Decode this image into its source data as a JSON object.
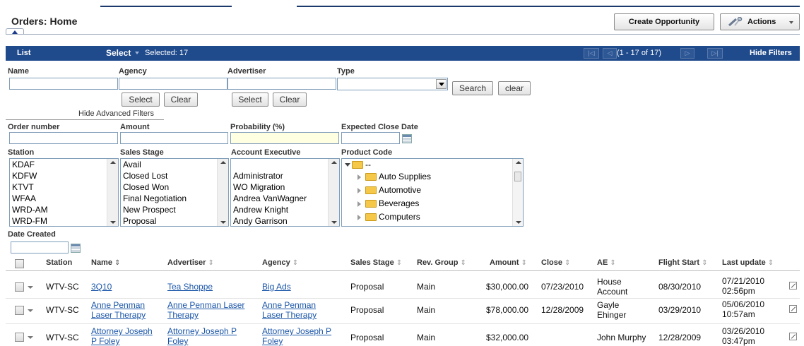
{
  "header": {
    "title": "Orders: Home",
    "create_label": "Create Opportunity",
    "actions_label": "Actions"
  },
  "listbar": {
    "list_label": "List",
    "select_label": "Select",
    "selected_text": "Selected:  17",
    "pager_text": "(1 - 17 of 17)",
    "hide_filters": "Hide Filters"
  },
  "filters": {
    "name_label": "Name",
    "agency_label": "Agency",
    "advertiser_label": "Advertiser",
    "type_label": "Type",
    "select_btn": "Select",
    "clear_btn": "Clear",
    "search_btn": "Search",
    "clear_lower_btn": "clear",
    "hide_advanced": "Hide Advanced Filters",
    "order_number_label": "Order number",
    "amount_label": "Amount",
    "probability_label": "Probability (%)",
    "expected_close_label": "Expected Close Date",
    "station_label": "Station",
    "sales_stage_label": "Sales Stage",
    "account_exec_label": "Account Executive",
    "product_code_label": "Product Code",
    "date_created_label": "Date Created",
    "stations": [
      "KDAF",
      "KDFW",
      "KTVT",
      "WFAA",
      "WRD-AM",
      "WRD-FM"
    ],
    "sales_stages": [
      "Avail",
      "Closed Lost",
      "Closed Won",
      "Final Negotiation",
      "New Prospect",
      "Proposal"
    ],
    "account_execs": [
      "",
      "Administrator",
      "WO Migration",
      "Andrea VanWagner",
      "Andrew Knight",
      "Andy Garrison"
    ],
    "product_root": "--",
    "product_codes": [
      "Auto Supplies",
      "Automotive",
      "Beverages",
      "Computers"
    ]
  },
  "table": {
    "headers": {
      "station": "Station",
      "name": "Name",
      "advertiser": "Advertiser",
      "agency": "Agency",
      "sales_stage": "Sales Stage",
      "rev_group": "Rev. Group",
      "amount": "Amount",
      "close": "Close",
      "ae": "AE",
      "flight_start": "Flight Start",
      "last_update": "Last update"
    },
    "rows": [
      {
        "station": "WTV-SC",
        "name": [
          "3Q10"
        ],
        "advertiser": [
          "Tea Shoppe"
        ],
        "agency": [
          "Big Ads"
        ],
        "sales_stage": "Proposal",
        "rev_group": "Main",
        "amount": "$30,000.00",
        "close": "07/23/2010",
        "ae": [
          "House",
          "Account"
        ],
        "flight_start": "08/30/2010",
        "last_update": [
          "07/21/2010",
          "02:56pm"
        ]
      },
      {
        "station": "WTV-SC",
        "name": [
          "Anne Penman",
          "Laser Therapy"
        ],
        "advertiser": [
          "Anne Penman Laser",
          "Therapy"
        ],
        "agency": [
          "Anne Penman",
          "Laser Therapy"
        ],
        "sales_stage": "Proposal",
        "rev_group": "Main",
        "amount": "$78,000.00",
        "close": "12/28/2009",
        "ae": [
          "Gayle",
          "Ehinger"
        ],
        "flight_start": "03/29/2010",
        "last_update": [
          "05/06/2010",
          "10:57am"
        ]
      },
      {
        "station": "WTV-SC",
        "name": [
          "Attorney Joseph",
          "P Foley"
        ],
        "advertiser": [
          "Attorney Joseph P",
          "Foley"
        ],
        "agency": [
          "Attorney Joseph P",
          "Foley"
        ],
        "sales_stage": "Proposal",
        "rev_group": "Main",
        "amount": "$32,000.00",
        "close": "",
        "ae": [
          "John Murphy"
        ],
        "flight_start": "12/28/2009",
        "last_update": [
          "03/26/2010",
          "03:47pm"
        ]
      }
    ]
  }
}
